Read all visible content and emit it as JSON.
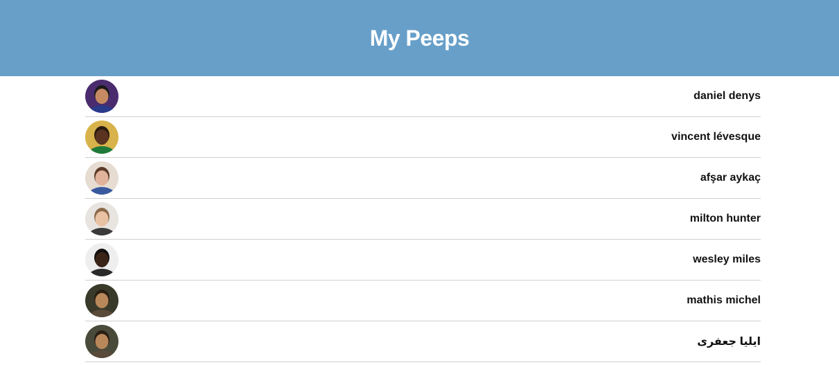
{
  "header": {
    "title": "My Peeps"
  },
  "colors": {
    "header_bg": "#679fc9",
    "divider": "#cfcfcf"
  },
  "people": [
    {
      "name": "daniel denys",
      "avatar": {
        "bg": "#4a2c6e",
        "skin": "#c68a63",
        "hair": "#1c1a1a",
        "shirt": "#2a3a8a"
      }
    },
    {
      "name": "vincent lévesque",
      "avatar": {
        "bg": "#d8b24a",
        "skin": "#5a3420",
        "hair": "#2a1a10",
        "shirt": "#1f7a3a"
      }
    },
    {
      "name": "afşar aykaç",
      "avatar": {
        "bg": "#e6dcd2",
        "skin": "#e0b39a",
        "hair": "#5b3a28",
        "shirt": "#3a5aa0"
      }
    },
    {
      "name": "milton hunter",
      "avatar": {
        "bg": "#e8e4e0",
        "skin": "#e9c2a4",
        "hair": "#8a6a4a",
        "shirt": "#3a3a3a"
      }
    },
    {
      "name": "wesley miles",
      "avatar": {
        "bg": "#eeeeee",
        "skin": "#3a2418",
        "hair": "#141010",
        "shirt": "#2a2a2a"
      }
    },
    {
      "name": "mathis michel",
      "avatar": {
        "bg": "#3a3a2a",
        "skin": "#b8875a",
        "hair": "#2a1e14",
        "shirt": "#5a4a3a"
      }
    },
    {
      "name": "ایلیا جعفری",
      "avatar": {
        "bg": "#4a4a3a",
        "skin": "#b8875a",
        "hair": "#2a1e14",
        "shirt": "#5a4a3a"
      }
    }
  ]
}
